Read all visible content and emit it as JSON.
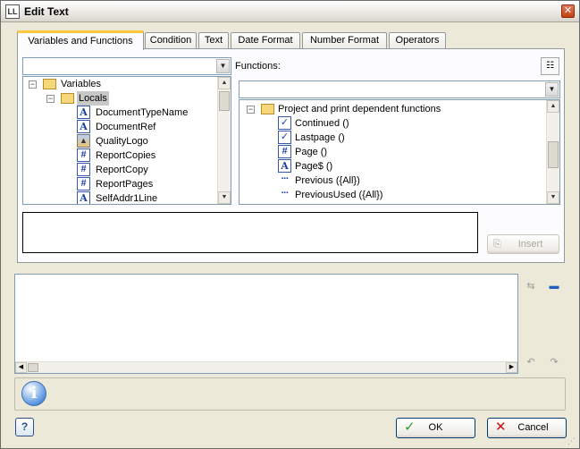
{
  "window": {
    "title": "Edit Text",
    "icon": "ll-app-icon"
  },
  "tabs": [
    {
      "label": "Variables and Functions",
      "active": true
    },
    {
      "label": "Condition"
    },
    {
      "label": "Text"
    },
    {
      "label": "Date Format"
    },
    {
      "label": "Number Format"
    },
    {
      "label": "Operators"
    }
  ],
  "variables_filter": {
    "value": ""
  },
  "variables_tree": [
    {
      "label": "Variables",
      "icon": "variables-folder-icon",
      "expander": "−"
    },
    {
      "label": "Locals",
      "icon": "folder-icon",
      "expander": "−",
      "selected": true
    },
    {
      "label": "DocumentTypeName",
      "icon": "text-variable-icon"
    },
    {
      "label": "DocumentRef",
      "icon": "text-variable-icon"
    },
    {
      "label": "QualityLogo",
      "icon": "picture-variable-icon"
    },
    {
      "label": "ReportCopies",
      "icon": "numeric-variable-icon"
    },
    {
      "label": "ReportCopy",
      "icon": "numeric-variable-icon"
    },
    {
      "label": "ReportPages",
      "icon": "numeric-variable-icon"
    },
    {
      "label": "SelfAddr1Line",
      "icon": "text-variable-icon"
    }
  ],
  "functions": {
    "label": "Functions:",
    "filter_value": "",
    "items": [
      {
        "label": "Project and print dependent functions",
        "icon": "folder-icon",
        "expander": "−"
      },
      {
        "label": "Continued ()",
        "icon": "boolean-function-icon"
      },
      {
        "label": "Lastpage ()",
        "icon": "boolean-function-icon"
      },
      {
        "label": "Page ()",
        "icon": "numeric-function-icon"
      },
      {
        "label": "Page$ ()",
        "icon": "text-function-icon"
      },
      {
        "label": "Previous ({All})",
        "icon": "any-function-icon"
      },
      {
        "label": "PreviousUsed ({All})",
        "icon": "any-function-icon"
      }
    ]
  },
  "description_box": {
    "text": ""
  },
  "insert_button": {
    "label": "Insert",
    "enabled": false
  },
  "editor": {
    "text": ""
  },
  "info_box": {
    "text": ""
  },
  "buttons": {
    "ok": "OK",
    "cancel": "Cancel",
    "help": "?"
  },
  "colors": {
    "accent_tab": "#ffc83c",
    "ok_check": "#2e9a2e",
    "cancel_x": "#cc1111",
    "info_blue": "#1f5fbf"
  }
}
